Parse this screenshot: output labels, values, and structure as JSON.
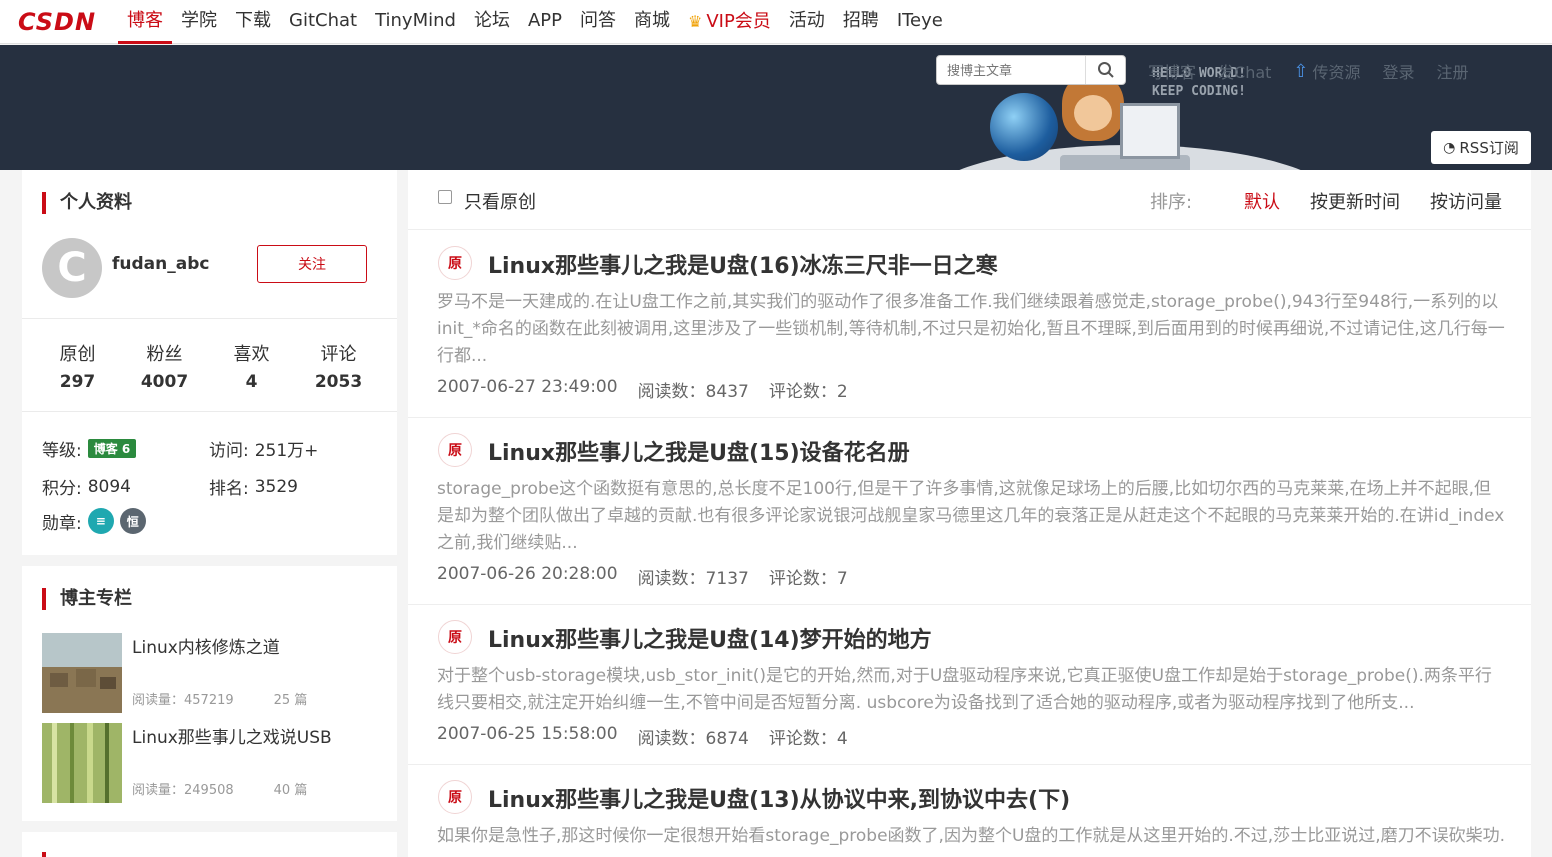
{
  "nav": {
    "logo": "CSDN",
    "items": [
      "博客",
      "学院",
      "下载",
      "GitChat",
      "TinyMind",
      "论坛",
      "APP",
      "问答",
      "商城",
      "VIP会员",
      "活动",
      "招聘",
      "ITeye"
    ]
  },
  "banner": {
    "search_placeholder": "搜博主文章",
    "hello_line1": "HELLO WORLD!",
    "hello_line2": "KEEP CODING!",
    "links": [
      "写博客",
      "发Chat",
      "传资源",
      "登录",
      "注册"
    ],
    "rss": "RSS订阅"
  },
  "profile": {
    "title": "个人资料",
    "username": "fudan_abc",
    "follow": "关注",
    "stats": [
      {
        "label": "原创",
        "value": "297"
      },
      {
        "label": "粉丝",
        "value": "4007"
      },
      {
        "label": "喜欢",
        "value": "4"
      },
      {
        "label": "评论",
        "value": "2053"
      }
    ],
    "level_label": "等级:",
    "level_badge": "博客 6",
    "visits_label": "访问:",
    "visits_value": "251万+",
    "points_label": "积分:",
    "points_value": "8094",
    "rank_label": "排名:",
    "rank_value": "3529",
    "medals_label": "勋章:",
    "medal_a": "≡",
    "medal_b": "恒"
  },
  "columns": {
    "title": "博主专栏",
    "items": [
      {
        "title": "Linux内核修炼之道",
        "reads": "阅读量：457219",
        "count": "25 篇"
      },
      {
        "title": "Linux那些事儿之戏说USB",
        "reads": "阅读量：249508",
        "count": "40 篇"
      }
    ]
  },
  "filter": {
    "only_original": "只看原创",
    "sort_label": "排序:",
    "sort_options": [
      "默认",
      "按更新时间",
      "按访问量"
    ]
  },
  "articles": [
    {
      "badge": "原",
      "title": "Linux那些事儿之我是U盘(16)冰冻三尺非一日之寒",
      "summary": "罗马不是一天建成的.在让U盘工作之前,其实我们的驱动作了很多准备工作.我们继续跟着感觉走,storage_probe(),943行至948行,一系列的以init_*命名的函数在此刻被调用,这里涉及了一些锁机制,等待机制,不过只是初始化,暂且不理睬,到后面用到的时候再细说,不过请记住,这几行每一行都...",
      "date": "2007-06-27 23:49:00",
      "reads": "阅读数：8437",
      "comments": "评论数：2"
    },
    {
      "badge": "原",
      "title": "Linux那些事儿之我是U盘(15)设备花名册",
      "summary": "storage_probe这个函数挺有意思的,总长度不足100行,但是干了许多事情,这就像足球场上的后腰,比如切尔西的马克莱莱,在场上并不起眼,但是却为整个团队做出了卓越的贡献.也有很多评论家说银河战舰皇家马德里这几年的衰落正是从赶走这个不起眼的马克莱莱开始的.在讲id_index之前,我们继续贴...",
      "date": "2007-06-26 20:28:00",
      "reads": "阅读数：7137",
      "comments": "评论数：7"
    },
    {
      "badge": "原",
      "title": "Linux那些事儿之我是U盘(14)梦开始的地方",
      "summary": "对于整个usb-storage模块,usb_stor_init()是它的开始,然而,对于U盘驱动程序来说,它真正驱使U盘工作却是始于storage_probe().两条平行线只要相交,就注定开始纠缠一生,不管中间是否短暂分离. usbcore为设备找到了适合她的驱动程序,或者为驱动程序找到了他所支...",
      "date": "2007-06-25 15:58:00",
      "reads": "阅读数：6874",
      "comments": "评论数：4"
    },
    {
      "badge": "原",
      "title": "Linux那些事儿之我是U盘(13)从协议中来,到协议中去(下)",
      "summary": "如果你是急性子,那这时候你一定很想开始看storage_probe函数了,因为整个U盘的工作就是从这里开始的.不过,莎士比亚说过,磨刀不误砍柴功.",
      "date": "",
      "reads": "",
      "comments": ""
    }
  ],
  "colors": {
    "accent": "#ca0c16",
    "banner_bg": "#263040"
  }
}
